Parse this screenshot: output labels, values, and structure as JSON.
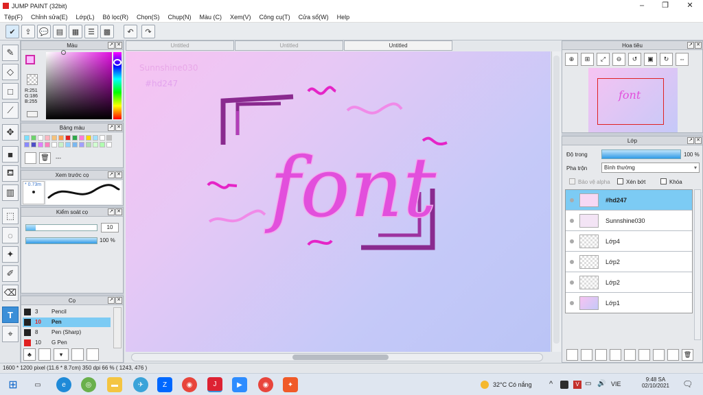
{
  "window": {
    "title": "JUMP PAINT (32bit)"
  },
  "menu": [
    "Tệp(F)",
    "Chỉnh sửa(E)",
    "Lớp(L)",
    "Bộ lọc(R)",
    "Chọn(S)",
    "Chụp(N)",
    "Màu (C)",
    "Xem(V)",
    "Công cụ(T)",
    "Cửa sổ(W)",
    "Help"
  ],
  "tabs": [
    "Untitled",
    "Untitled",
    "Untitled"
  ],
  "panels": {
    "color": {
      "title": "Màu",
      "r": "R:251",
      "g": "G:186",
      "b": "B:255"
    },
    "palette": {
      "title": "Bảng màu",
      "dash": "---"
    },
    "brush_preview": {
      "title": "Xem trước cọ",
      "size": "* 0.73m"
    },
    "brush_control": {
      "title": "Kiểm soát cọ",
      "size_value": "10",
      "opacity_value": "100 %",
      "size_fill": 0.14,
      "opacity_fill": 1.0
    },
    "brushes": {
      "title": "Cọ",
      "items": [
        {
          "num": "3",
          "name": "Pencil",
          "color": "#222222"
        },
        {
          "num": "10",
          "name": "Pen",
          "color": "#222222",
          "selected": true
        },
        {
          "num": "8",
          "name": "Pen (Sharp)",
          "color": "#222222"
        },
        {
          "num": "10",
          "name": "G Pen",
          "color": "#e02020"
        }
      ]
    },
    "navigator": {
      "title": "Hoa tiêu"
    },
    "layers": {
      "title": "Lớp",
      "opacity_label": "Độ trong",
      "opacity_value": "100 %",
      "blend_label": "Pha trộn",
      "blend_value": "Bình thường",
      "alpha_label": "Bảo vệ alpha",
      "clip_label": "Xén bớt",
      "lock_label": "Khóa",
      "items": [
        {
          "name": "#hd247",
          "selected": true
        },
        {
          "name": "Sunnshine030"
        },
        {
          "name": "Lớp4"
        },
        {
          "name": "Lớp2"
        },
        {
          "name": "Lớp2"
        },
        {
          "name": "Lớp1"
        }
      ]
    }
  },
  "artwork": {
    "watermark1": "Sunnshine030",
    "watermark2": "#hd247",
    "word": "font"
  },
  "status": {
    "text": "1600 * 1200 pixel   (11.6 * 8.7cm)  350 dpi   66 %   ( 1243, 476 )"
  },
  "taskbar": {
    "weather": "32°C  Có nắng",
    "lang": "VIE",
    "time": "9:48 SA",
    "date": "02/10/2021"
  },
  "colors": {
    "accent": "#3b8fd8",
    "selected_row": "#7ccbf4",
    "art_pink": "#e24fdc",
    "art_purple": "#8a2a8f"
  }
}
